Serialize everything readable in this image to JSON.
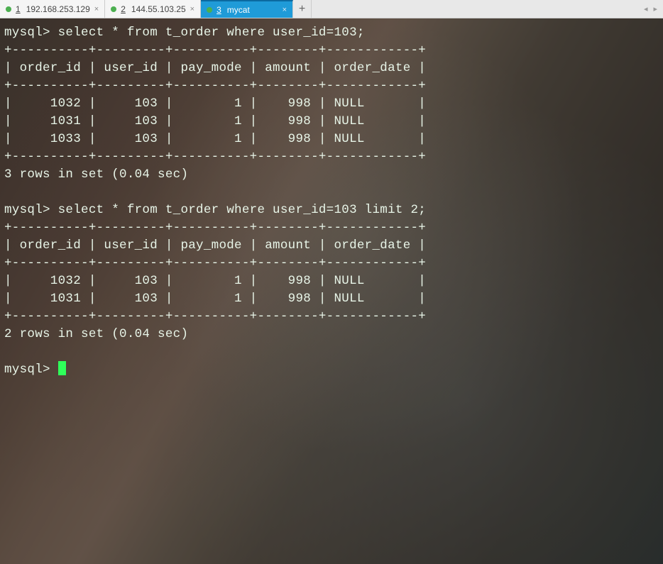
{
  "tabs": [
    {
      "index": "1",
      "label": "192.168.253.129",
      "active": false
    },
    {
      "index": "2",
      "label": "144.55.103.25",
      "active": false
    },
    {
      "index": "3",
      "label": "mycat",
      "active": true
    }
  ],
  "prompt": "mysql>",
  "queries": [
    {
      "sql": "select * from t_order where user_id=103;",
      "columns": [
        "order_id",
        "user_id",
        "pay_mode",
        "amount",
        "order_date"
      ],
      "rows": [
        {
          "order_id": 1032,
          "user_id": 103,
          "pay_mode": 1,
          "amount": 998,
          "order_date": "NULL"
        },
        {
          "order_id": 1031,
          "user_id": 103,
          "pay_mode": 1,
          "amount": 998,
          "order_date": "NULL"
        },
        {
          "order_id": 1033,
          "user_id": 103,
          "pay_mode": 1,
          "amount": 998,
          "order_date": "NULL"
        }
      ],
      "summary": "3 rows in set (0.04 sec)"
    },
    {
      "sql": "select * from t_order where user_id=103 limit 2;",
      "columns": [
        "order_id",
        "user_id",
        "pay_mode",
        "amount",
        "order_date"
      ],
      "rows": [
        {
          "order_id": 1032,
          "user_id": 103,
          "pay_mode": 1,
          "amount": 998,
          "order_date": "NULL"
        },
        {
          "order_id": 1031,
          "user_id": 103,
          "pay_mode": 1,
          "amount": 998,
          "order_date": "NULL"
        }
      ],
      "summary": "2 rows in set (0.04 sec)"
    }
  ],
  "col_widths": {
    "order_id": 10,
    "user_id": 9,
    "pay_mode": 10,
    "amount": 8,
    "order_date": 12
  }
}
